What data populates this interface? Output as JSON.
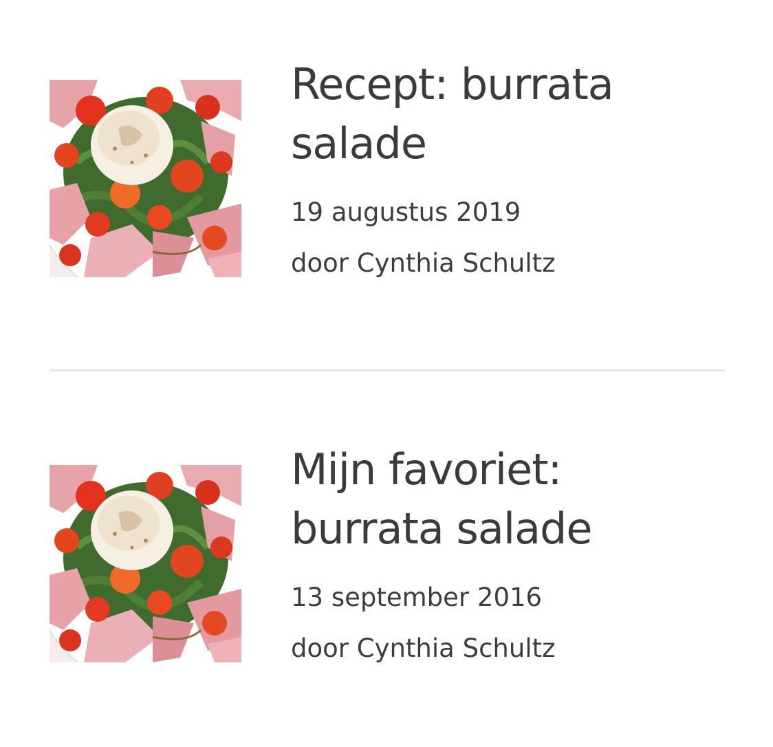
{
  "articles": [
    {
      "title": "Recept: burrata salade",
      "date": "19 augustus 2019",
      "author": "door Cynthia Schultz",
      "image_icon": "burrata-salad-photo"
    },
    {
      "title": "Mijn favoriet: burrata salade",
      "date": "13 september 2016",
      "author": "door Cynthia Schultz",
      "image_icon": "burrata-salad-photo"
    }
  ],
  "colors": {
    "text": "#3d3d3d",
    "divider": "#e6e6e6",
    "background": "#ffffff"
  }
}
